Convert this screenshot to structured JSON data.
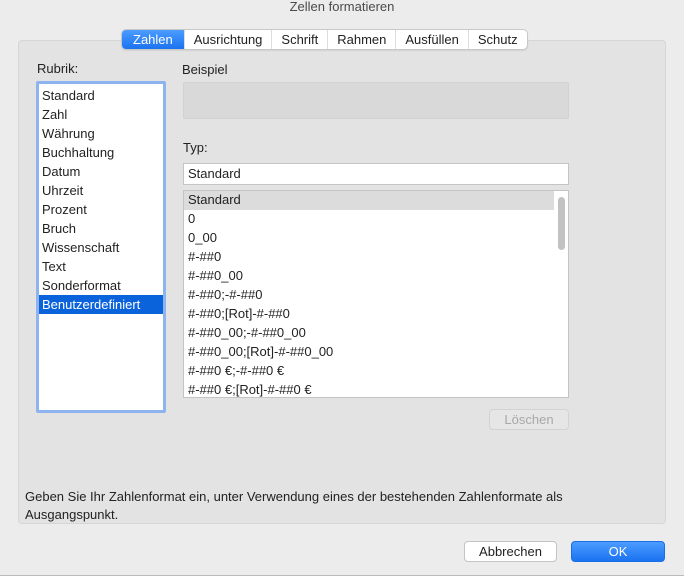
{
  "window": {
    "title": "Zellen formatieren"
  },
  "tabs": [
    "Zahlen",
    "Ausrichtung",
    "Schrift",
    "Rahmen",
    "Ausfüllen",
    "Schutz"
  ],
  "rubrik": {
    "label": "Rubrik:",
    "items": [
      "Standard",
      "Zahl",
      "Währung",
      "Buchhaltung",
      "Datum",
      "Uhrzeit",
      "Prozent",
      "Bruch",
      "Wissenschaft",
      "Text",
      "Sonderformat",
      "Benutzerdefiniert"
    ],
    "selected": "Benutzerdefiniert"
  },
  "beispiel": {
    "label": "Beispiel"
  },
  "typ": {
    "label": "Typ:",
    "value": "Standard"
  },
  "formats": [
    "Standard",
    "0",
    "0_00",
    "#-##0",
    "#-##0_00",
    "#-##0;-#-##0",
    "#-##0;[Rot]-#-##0",
    "#-##0_00;-#-##0_00",
    "#-##0_00;[Rot]-#-##0_00",
    "#-##0 €;-#-##0 €",
    "#-##0 €;[Rot]-#-##0 €"
  ],
  "buttons": {
    "delete": "Löschen",
    "cancel": "Abbrechen",
    "ok": "OK"
  },
  "help": "Geben Sie Ihr Zahlenformat ein, unter Verwendung eines der bestehenden Zahlenformate als Ausgangspunkt."
}
